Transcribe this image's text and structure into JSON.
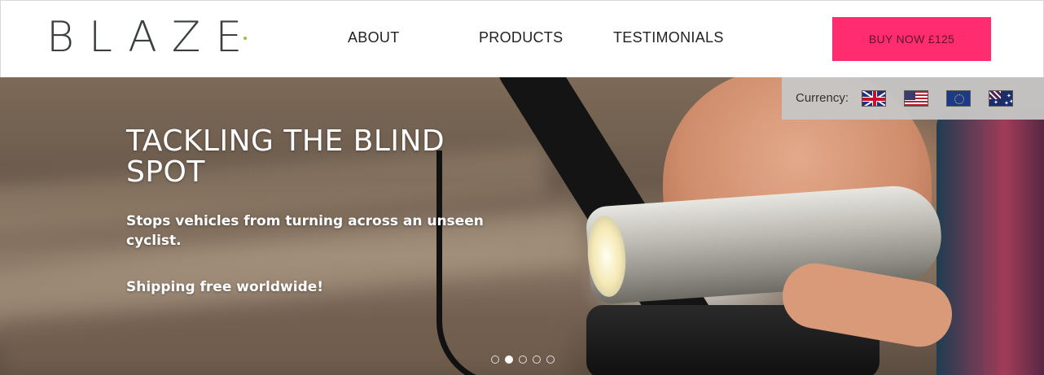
{
  "header": {
    "logo_text": "BLAZE",
    "nav": {
      "about": "ABOUT",
      "products": "PRODUCTS",
      "testimonials": "TESTIMONIALS"
    },
    "buy_label": "BUY NOW £125",
    "buy_color": "#ff2d6f"
  },
  "currency": {
    "label": "Currency:",
    "flags": [
      "uk-flag-icon",
      "us-flag-icon",
      "eu-flag-icon",
      "au-flag-icon"
    ]
  },
  "hero": {
    "title": "TACKLING THE BLIND SPOT",
    "subtitle": "Stops vehicles from turning across an unseen cyclist.",
    "shipping": "Shipping free worldwide!",
    "slides": 5,
    "active_slide": 2
  }
}
